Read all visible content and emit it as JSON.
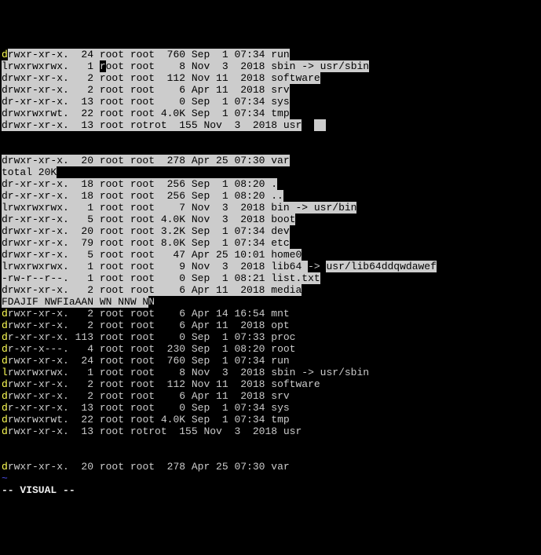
{
  "lines": [
    {
      "hlFirst": true,
      "parts": [
        {
          "t": "d",
          "sel": false
        },
        {
          "t": "rwxr-xr-x.  24 root root  760 Sep  1 07:34 run",
          "sel": true
        }
      ]
    },
    {
      "parts": [
        {
          "t": "lrwxrwxrwx.   1 ",
          "sel": true
        },
        {
          "t": "r",
          "sel": false
        },
        {
          "t": "oot root    8 Nov  3  2018 sbin -> usr/sbin",
          "sel": true
        }
      ]
    },
    {
      "parts": [
        {
          "t": "drwxr-xr-x.   2 root root  112 Nov 11  2018 software",
          "sel": true
        }
      ]
    },
    {
      "parts": [
        {
          "t": "drwxr-xr-x.   2 root root    6 Apr 11  2018 srv",
          "sel": true
        }
      ]
    },
    {
      "parts": [
        {
          "t": "dr-xr-xr-x.  13 root root    0 Sep  1 07:34 sys",
          "sel": true
        }
      ]
    },
    {
      "parts": [
        {
          "t": "drwxrwxrwt.  22 root root 4.0K Sep  1 07:34 tmp",
          "sel": true
        }
      ]
    },
    {
      "parts": [
        {
          "t": "drwxr-xr-x.  13 root rotrot  155 Nov  3  2018 usr",
          "sel": true
        },
        {
          "t": "  ",
          "sel": false
        },
        {
          "t": "  ",
          "sel": true
        }
      ]
    },
    {
      "parts": [
        {
          "t": "",
          "sel": false
        }
      ]
    },
    {
      "parts": [
        {
          "t": "",
          "sel": false
        }
      ]
    },
    {
      "parts": [
        {
          "t": "drwxr-xr-x.  20 root root  278 Apr 25 07:30 var",
          "sel": true
        }
      ]
    },
    {
      "parts": [
        {
          "t": "total 20K",
          "sel": true
        },
        {
          "t": "     ",
          "sel": false
        }
      ]
    },
    {
      "parts": [
        {
          "t": "dr-xr-xr-x.  18 root root  256 Sep  1 08:20 .",
          "sel": true
        }
      ]
    },
    {
      "parts": [
        {
          "t": "dr-xr-xr-x.  18 root root  256 Sep  1 08:20 ..",
          "sel": true
        }
      ]
    },
    {
      "parts": [
        {
          "t": "lrwxrwxrwx.   1 root root    7 Nov  3  2018 bin -> usr/bin",
          "sel": true
        }
      ]
    },
    {
      "parts": [
        {
          "t": "dr-xr-xr-x.   5 root root 4.0K Nov  3  2018 boot",
          "sel": true
        }
      ]
    },
    {
      "parts": [
        {
          "t": "drwxr-xr-x.  20 root root 3.2K Sep  1 07:34 dev",
          "sel": true
        }
      ]
    },
    {
      "parts": [
        {
          "t": "drwxr-xr-x.  79 root root 8.0K Sep  1 07:34 etc",
          "sel": true
        }
      ]
    },
    {
      "parts": [
        {
          "t": "drwxr-xr-x.   5 root root   47 Apr 25 10:01 home0",
          "sel": true
        }
      ]
    },
    {
      "parts": [
        {
          "t": "lrwxrwxrwx.   1 root root    9 Nov  3  2018 lib64 ",
          "sel": true
        },
        {
          "t": "-> ",
          "sel": false
        },
        {
          "t": "usr/lib64ddqwdawef",
          "sel": true
        }
      ]
    },
    {
      "parts": [
        {
          "t": "-rw-r--r--.   1 root root    0 Sep  1 08:21 list.txt",
          "sel": true
        }
      ]
    },
    {
      "parts": [
        {
          "t": "drwxr-xr-x.   2 root root    6 Apr 11  2018 media",
          "sel": true
        }
      ]
    },
    {
      "parts": [
        {
          "t": "FDAJIF NWFIaAAN WN NNW N",
          "sel": true
        },
        {
          "t": "N",
          "sel": false
        }
      ]
    },
    {
      "hlFirst": true,
      "parts": [
        {
          "t": "drwxr-xr-x.   2 root root    6 Apr 14 16:54 mnt",
          "sel": false
        }
      ]
    },
    {
      "hlFirst": true,
      "parts": [
        {
          "t": "drwxr-xr-x.   2 root root    6 Apr 11  2018 opt",
          "sel": false
        }
      ]
    },
    {
      "hlFirst": true,
      "parts": [
        {
          "t": "dr-xr-xr-x. 113 root root    0 Sep  1 07:33 proc",
          "sel": false
        }
      ]
    },
    {
      "hlFirst": true,
      "parts": [
        {
          "t": "dr-xr-x---.   4 root root  230 Sep  1 08:20 root",
          "sel": false
        }
      ]
    },
    {
      "hlFirst": true,
      "parts": [
        {
          "t": "drwxr-xr-x.  24 root root  760 Sep  1 07:34 run",
          "sel": false
        }
      ]
    },
    {
      "hlFirst": true,
      "parts": [
        {
          "t": "lrwxrwxrwx.   1 root root    8 Nov  3  2018 sbin -> usr/sbin",
          "sel": false
        }
      ]
    },
    {
      "hlFirst": true,
      "parts": [
        {
          "t": "drwxr-xr-x.   2 root root  112 Nov 11  2018 software",
          "sel": false
        }
      ]
    },
    {
      "hlFirst": true,
      "parts": [
        {
          "t": "drwxr-xr-x.   2 root root    6 Apr 11  2018 srv",
          "sel": false
        }
      ]
    },
    {
      "hlFirst": true,
      "parts": [
        {
          "t": "dr-xr-xr-x.  13 root root    0 Sep  1 07:34 sys",
          "sel": false
        }
      ]
    },
    {
      "hlFirst": true,
      "parts": [
        {
          "t": "drwxrwxrwt.  22 root root 4.0K Sep  1 07:34 tmp",
          "sel": false
        }
      ]
    },
    {
      "hlFirst": true,
      "parts": [
        {
          "t": "drwxr-xr-x.  13 root rotrot  155 Nov  3  2018 usr",
          "sel": false
        }
      ]
    },
    {
      "parts": [
        {
          "t": "",
          "sel": false
        }
      ]
    },
    {
      "parts": [
        {
          "t": "",
          "sel": false
        }
      ]
    },
    {
      "hlFirst": true,
      "parts": [
        {
          "t": "drwxr-xr-x.  20 root root  278 Apr 25 07:30 var",
          "sel": false
        }
      ]
    },
    {
      "tilde": true,
      "parts": [
        {
          "t": "~",
          "sel": false
        }
      ]
    },
    {
      "bold": true,
      "parts": [
        {
          "t": "-- VISUAL --",
          "sel": false
        }
      ]
    }
  ]
}
